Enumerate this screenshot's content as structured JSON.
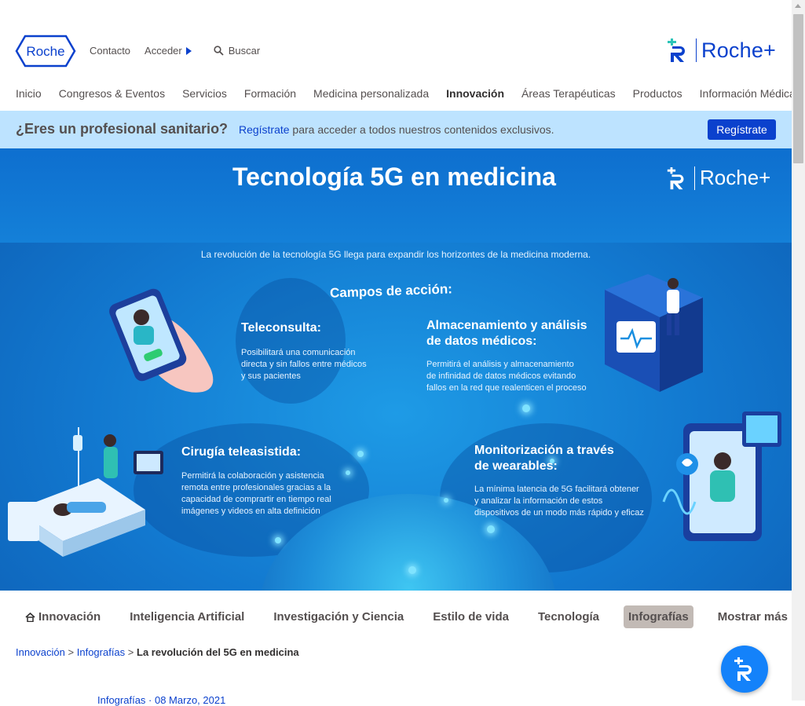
{
  "header": {
    "logo_text": "Roche",
    "links": {
      "contacto": "Contacto",
      "acceder": "Acceder"
    },
    "search": {
      "placeholder": "Buscar"
    },
    "rocheplus_text": "Roche+"
  },
  "main_nav": [
    {
      "label": "Inicio"
    },
    {
      "label": "Congresos & Eventos"
    },
    {
      "label": "Servicios"
    },
    {
      "label": "Formación"
    },
    {
      "label": "Medicina personalizada"
    },
    {
      "label": "Innovación",
      "active": true
    },
    {
      "label": "Áreas Terapéuticas"
    },
    {
      "label": "Productos"
    },
    {
      "label": "Información Médica"
    }
  ],
  "banner": {
    "title": "¿Eres un profesional sanitario?",
    "link": "Regístrate",
    "text": " para acceder a todos nuestros contenidos exclusivos.",
    "button": "Regístrate"
  },
  "hero": {
    "title": "Tecnología 5G en medicina",
    "logo_text": "Roche+",
    "subtitle": "La revolución de la tecnología 5G llega para expandir los horizontes de la medicina moderna.",
    "campos": "Campos de acción:",
    "sections": {
      "teleconsulta": {
        "title": "Teleconsulta:",
        "body": [
          "Posibilitará una comunicación",
          "directa y sin fallos entre médicos",
          "y sus pacientes"
        ]
      },
      "almacenamiento": {
        "title": [
          "Almacenamiento y análisis",
          "de datos médicos:"
        ],
        "body": [
          "Permitirá el análisis y almacenamiento",
          "de infinidad de datos médicos evitando",
          "fallos en la red que realenticen el proceso"
        ]
      },
      "cirugia": {
        "title": "Cirugía teleasistida:",
        "body": [
          "Permitirá la colaboración y asistencia",
          "remota entre profesionales gracias a la",
          "capacidad de comprartir en tiempo real",
          "imágenes y videos en alta definición"
        ]
      },
      "monitorizacion": {
        "title": [
          "Monitorización a través",
          "de wearables:"
        ],
        "body": [
          "La mínima latencia de 5G facilitará obtener",
          "y analizar la información de estos",
          "dispositivos de un modo más rápido y eficaz"
        ]
      }
    }
  },
  "subnav": {
    "items": [
      {
        "label": "Innovación",
        "icon": "home-icon"
      },
      {
        "label": "Inteligencia Artificial"
      },
      {
        "label": "Investigación y Ciencia"
      },
      {
        "label": "Estilo de vida"
      },
      {
        "label": "Tecnología"
      },
      {
        "label": "Infografías",
        "active": true
      }
    ],
    "more": "Mostrar más"
  },
  "breadcrumb": {
    "items": [
      "Innovación",
      "Infografías"
    ],
    "separator": ">",
    "current": "La revolución del 5G en medicina"
  },
  "meta": "Infografías · 08 Marzo, 2021",
  "colors": {
    "brand_blue": "#0b41cd",
    "banner_bg": "#bde3ff",
    "active_tab_bg": "#c2bab5",
    "fab_bg": "#1482fa"
  }
}
